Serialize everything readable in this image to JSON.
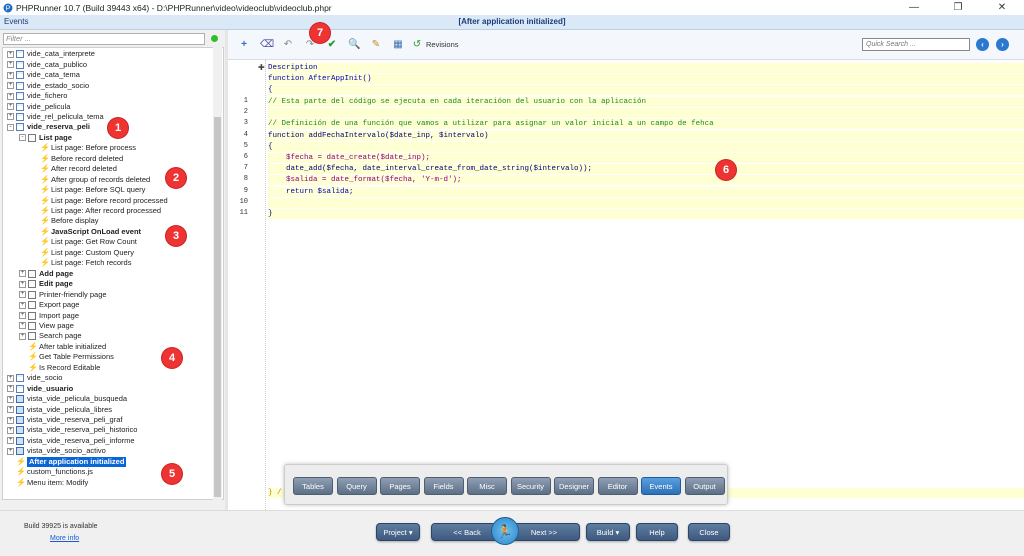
{
  "window": {
    "title": "PHPRunner 10.7 (Build 39443 x64) - D:\\PHPRunner\\video\\videoclub\\videoclub.phpr",
    "minimize": "—",
    "maximize": "❐",
    "close": "✕"
  },
  "header": {
    "left_label": "Events",
    "center_label": "[After application initialized]"
  },
  "filter": {
    "placeholder": "Filter ..."
  },
  "tree": [
    {
      "label": "vide_cata_interprete",
      "type": "table",
      "expand": "+"
    },
    {
      "label": "vide_cata_publico",
      "type": "table",
      "expand": "+"
    },
    {
      "label": "vide_cata_tema",
      "type": "table",
      "expand": "+"
    },
    {
      "label": "vide_estado_socio",
      "type": "table",
      "expand": "+"
    },
    {
      "label": "vide_fichero",
      "type": "table",
      "expand": "+"
    },
    {
      "label": "vide_pelicula",
      "type": "table",
      "expand": "+"
    },
    {
      "label": "vide_rel_pelicula_tema",
      "type": "table",
      "expand": "+"
    },
    {
      "label": "vide_reserva_peli",
      "type": "table",
      "expand": "-",
      "bold": true
    },
    {
      "label": "List page",
      "type": "page",
      "expand": "-",
      "bold": true
    },
    {
      "label": "List page: Before process",
      "type": "event"
    },
    {
      "label": "Before record deleted",
      "type": "event"
    },
    {
      "label": "After record deleted",
      "type": "event"
    },
    {
      "label": "After group of records deleted",
      "type": "event"
    },
    {
      "label": "List page: Before SQL query",
      "type": "event"
    },
    {
      "label": "List page: Before record processed",
      "type": "event"
    },
    {
      "label": "List page: After record processed",
      "type": "event"
    },
    {
      "label": "Before display",
      "type": "event"
    },
    {
      "label": "JavaScript OnLoad event",
      "type": "event",
      "bold": true
    },
    {
      "label": "List page: Get Row Count",
      "type": "event"
    },
    {
      "label": "List page: Custom Query",
      "type": "event"
    },
    {
      "label": "List page: Fetch records",
      "type": "event"
    },
    {
      "label": "Add page",
      "type": "page",
      "expand": "+",
      "bold": true
    },
    {
      "label": "Edit page",
      "type": "page",
      "expand": "+",
      "bold": true
    },
    {
      "label": "Printer-friendly page",
      "type": "page",
      "expand": "+"
    },
    {
      "label": "Export page",
      "type": "page",
      "expand": "+"
    },
    {
      "label": "Import page",
      "type": "page",
      "expand": "+"
    },
    {
      "label": "View page",
      "type": "page",
      "expand": "+"
    },
    {
      "label": "Search page",
      "type": "page",
      "expand": "+"
    },
    {
      "label": "After table initialized",
      "type": "event"
    },
    {
      "label": "Get Table Permissions",
      "type": "event"
    },
    {
      "label": "Is Record Editable",
      "type": "event"
    },
    {
      "label": "vide_socio",
      "type": "table",
      "expand": "+"
    },
    {
      "label": "vide_usuario",
      "type": "table",
      "expand": "+",
      "bold": true
    },
    {
      "label": "vista_vide_pelicula_busqueda",
      "type": "view",
      "expand": "+"
    },
    {
      "label": "vista_vide_pelicula_libres",
      "type": "view",
      "expand": "+"
    },
    {
      "label": "vista_vide_reserva_peli_graf",
      "type": "view",
      "expand": "+"
    },
    {
      "label": "vista_vide_reserva_peli_historico",
      "type": "view",
      "expand": "+"
    },
    {
      "label": "vista_vide_reserva_peli_informe",
      "type": "view",
      "expand": "+"
    },
    {
      "label": "vista_vide_socio_activo",
      "type": "view",
      "expand": "+"
    },
    {
      "label": "After application initialized",
      "type": "event",
      "bold": true,
      "selected": true
    },
    {
      "label": "custom_functions.js",
      "type": "event"
    },
    {
      "label": "Menu item: Modify",
      "type": "event"
    }
  ],
  "toolbar": {
    "revisions_label": "Revisions",
    "quick_search_placeholder": "Quick Search ...",
    "icons": [
      "plus-icon",
      "eraser-icon",
      "undo-icon",
      "redo-icon",
      "check-icon",
      "find-icon",
      "insert-icon",
      "sql-icon",
      "revisions-icon"
    ]
  },
  "editor": {
    "description_label": "Description",
    "header_lines": [
      "function AfterAppInit()",
      "{"
    ],
    "lines": [
      {
        "n": "1",
        "text": "// Esta parte del código se ejecuta en cada iteracióon del usuario con la aplicación",
        "cls": "c-cm"
      },
      {
        "n": "2",
        "text": "",
        "cls": ""
      },
      {
        "n": "3",
        "text": "// Definición de una función que vamos a utilizar para asignar un valor inicial a un campo de fehca",
        "cls": "c-cm"
      },
      {
        "n": "4",
        "text": "function addFechaIntervalo($date_inp, $intervalo)",
        "cls": "c-fn"
      },
      {
        "n": "5",
        "text": "{",
        "cls": "c-fn"
      },
      {
        "n": "6",
        "text": "    $fecha = date_create($date_inp);",
        "cls": "c-var"
      },
      {
        "n": "7",
        "text": "    date_add($fecha, date_interval_create_from_date_string($intervalo));",
        "cls": "c-fn"
      },
      {
        "n": "8",
        "text": "    $salida = date_format($fecha, 'Y-m-d');",
        "cls": "c-var"
      },
      {
        "n": "9",
        "text": "    return $salida;",
        "cls": "c-kw"
      },
      {
        "n": "10",
        "text": "",
        "cls": ""
      },
      {
        "n": "11",
        "text": "}",
        "cls": "c-fn"
      }
    ],
    "footer_text": "} /"
  },
  "floatbar": {
    "buttons": [
      "Tables",
      "Query",
      "Pages",
      "Fields",
      "Misc",
      "Security",
      "Designer",
      "Editor",
      "Events",
      "Output"
    ],
    "active": "Events"
  },
  "bottom": {
    "build_available": "Build 39925 is available",
    "more_info": "More info",
    "project": "Project",
    "back": "<< Back",
    "next": "Next >>",
    "build": "Build",
    "help": "Help",
    "close": "Close"
  },
  "badges": [
    "1",
    "2",
    "3",
    "4",
    "5",
    "6",
    "7"
  ],
  "colors": {
    "accent": "#0a66d6",
    "badge": "#e33333",
    "button": "#4a6790"
  }
}
